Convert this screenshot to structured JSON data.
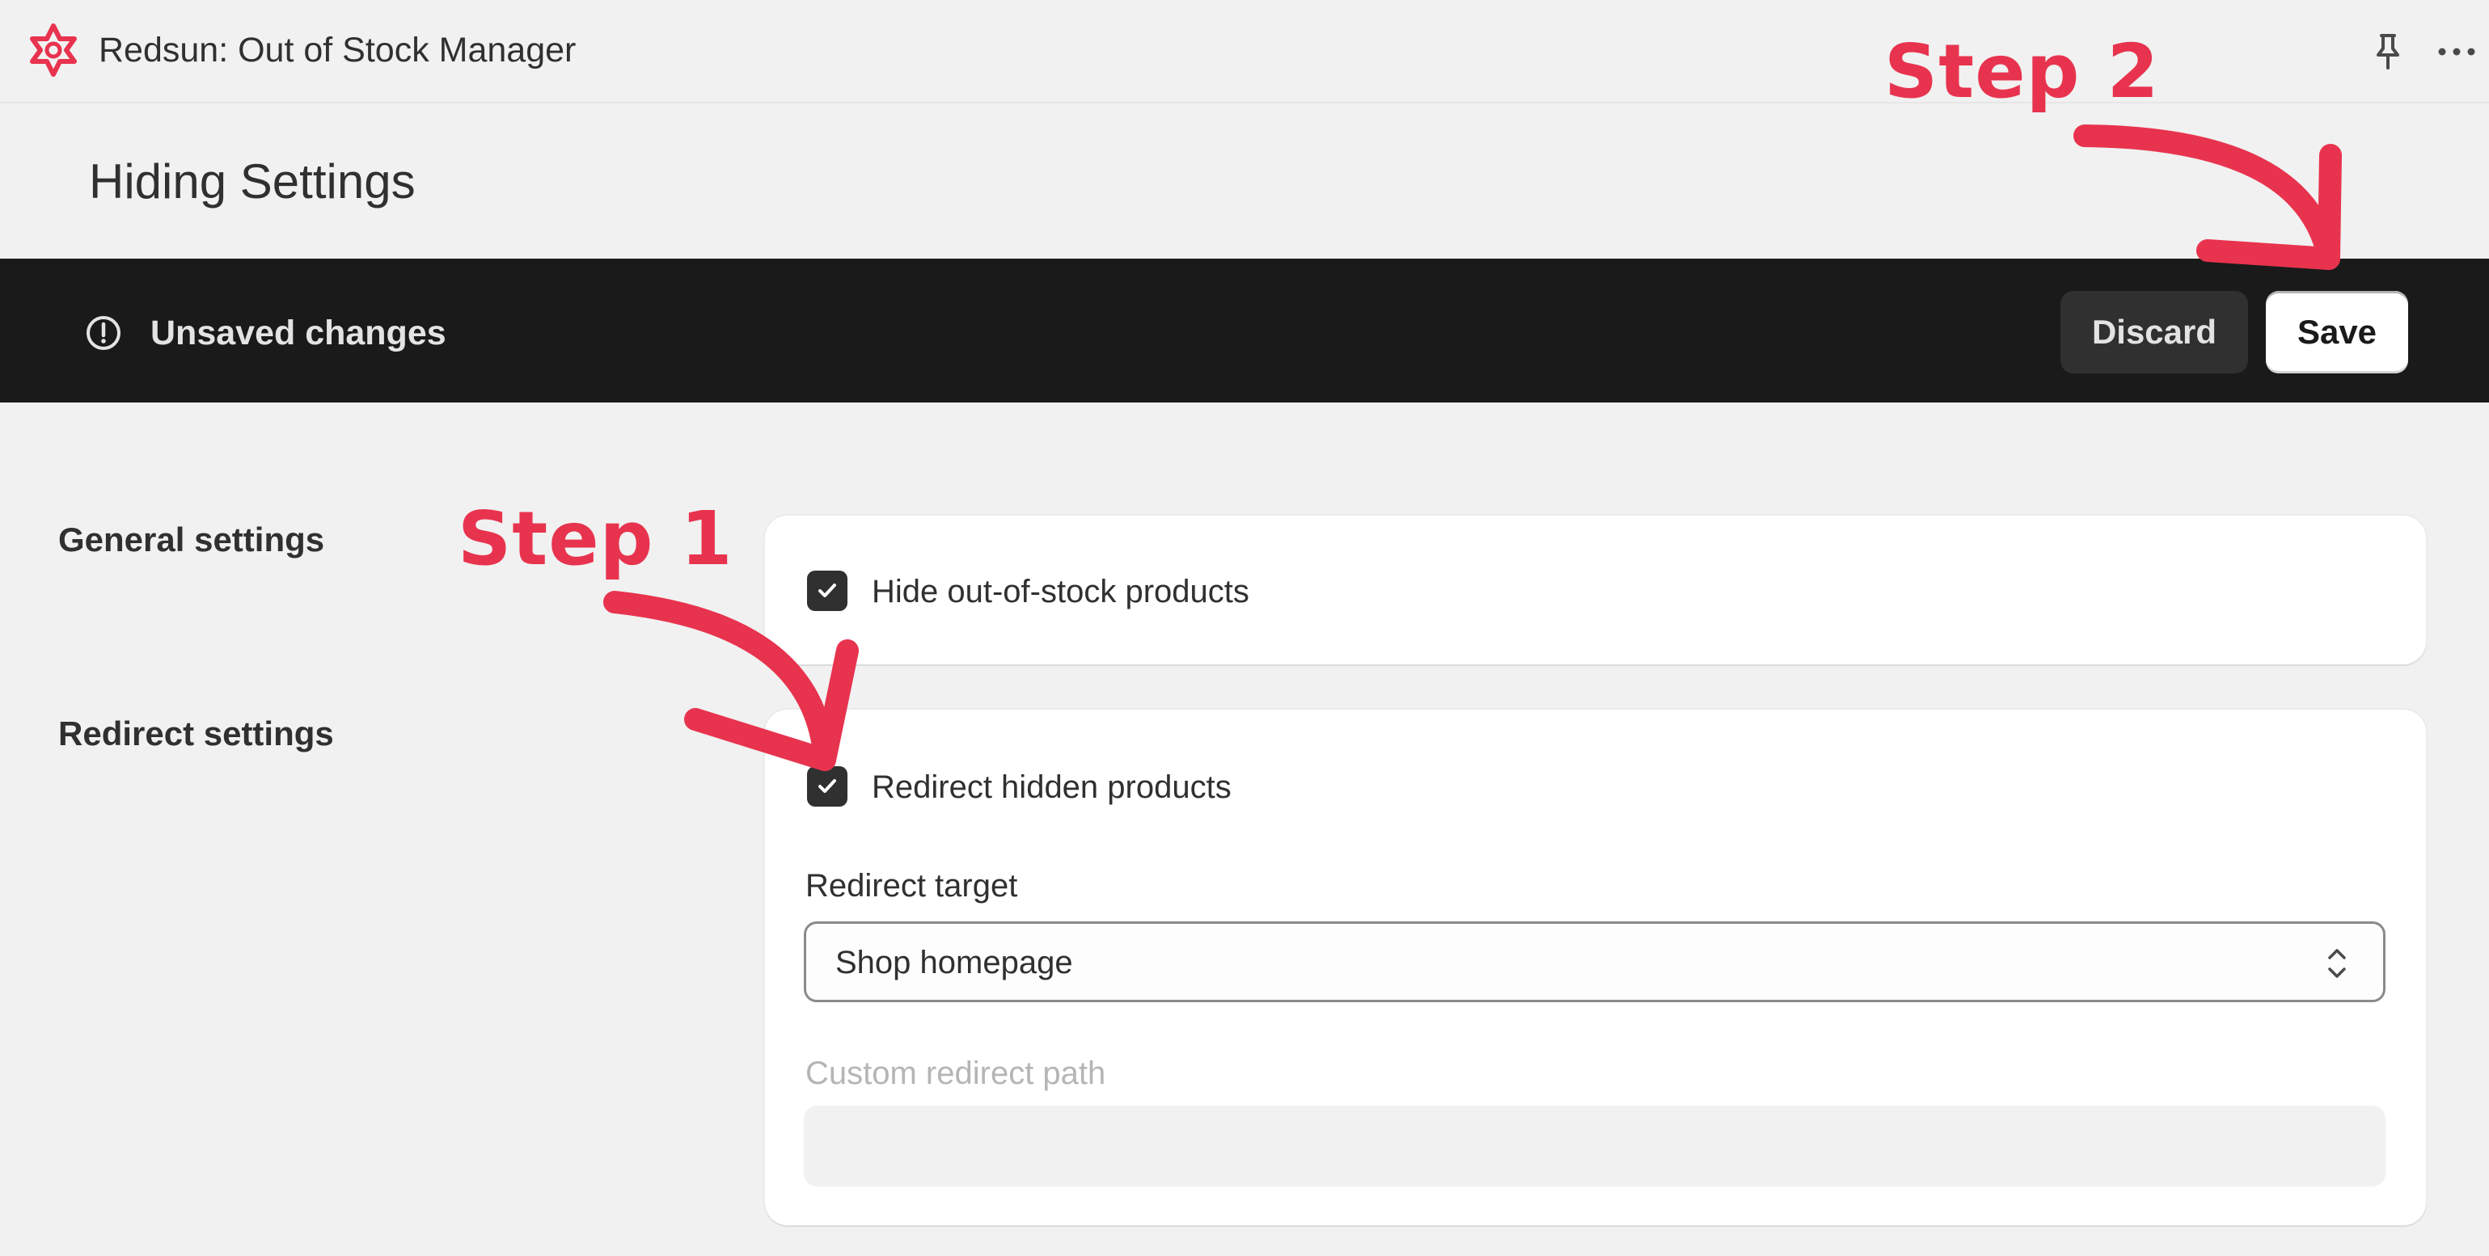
{
  "app": {
    "title": "Redsun: Out of Stock Manager",
    "logo_icon": "redsun-star-icon",
    "pin_icon": "pin-icon",
    "more_icon": "more-horizontal-icon"
  },
  "page": {
    "title": "Hiding Settings"
  },
  "save_bar": {
    "message": "Unsaved changes",
    "alert_icon": "alert-circle-icon",
    "discard_label": "Discard",
    "save_label": "Save"
  },
  "sections": {
    "general": {
      "label": "General settings",
      "hide_out_of_stock": {
        "label": "Hide out-of-stock products",
        "checked": true
      }
    },
    "redirect": {
      "label": "Redirect settings",
      "redirect_hidden": {
        "label": "Redirect hidden products",
        "checked": true
      },
      "target": {
        "label": "Redirect target",
        "value": "Shop homepage"
      },
      "custom_path": {
        "label": "Custom redirect path",
        "value": "",
        "disabled": true
      }
    }
  },
  "annotations": {
    "step1": "Step 1",
    "step2": "Step 2",
    "color": "#e8334e"
  },
  "colors": {
    "background": "#f1f1f1",
    "bar": "#1a1a1a",
    "card": "#ffffff",
    "checkbox": "#303030",
    "brand": "#e8334e"
  }
}
